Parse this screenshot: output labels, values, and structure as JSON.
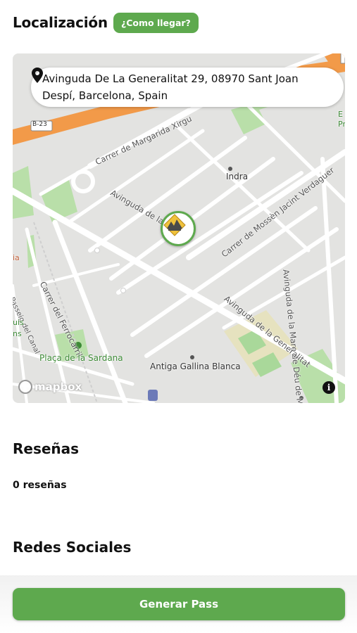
{
  "location": {
    "title": "Localización",
    "directions_label": "¿Como llegar?"
  },
  "map": {
    "address": "Avinguda De La Generalitat 29, 08970 Sant Joan Despí, Barcelona, Spain",
    "labels": {
      "carrer_margarida": "Carrer de Margarida Xirgu",
      "avinguda_generalitat_top": "Avinguda de la Ge",
      "avinguda_generalitat_bottom": "Avinguda de la Generalitat",
      "carrer_mossen": "Carrer de Mossèn Jacint Verdaguer",
      "avinguda_mare": "Avinguda de la Mare de Déu de Montserrat",
      "carrer_ferrocarril": "Carrer del Ferrocarril",
      "passeig_canal": "Passeig del Canal",
      "placa_sardana": "Plaça de la Sardana",
      "indra": "Indra",
      "antiga_gallina": "Antiga Gallina Blanca",
      "road_shield": "B-23",
      "edge_left_a": "ia",
      "edge_left_b": "uis",
      "edge_left_c": "ns",
      "edge_right": "E\nPr"
    },
    "attribution": "mapbox",
    "info_icon": "info-icon",
    "pin_icon": "location-pin-icon",
    "marker_icon": "venue-logo-icon"
  },
  "reviews": {
    "title": "Reseñas",
    "count_text": "0 reseñas"
  },
  "social": {
    "title": "Redes Sociales"
  },
  "footer": {
    "button_label": "Generar Pass"
  },
  "colors": {
    "accent": "#5ea94e",
    "highway": "#f29a49",
    "map_bg": "#e3e3e1",
    "park": "#a9d89a"
  }
}
